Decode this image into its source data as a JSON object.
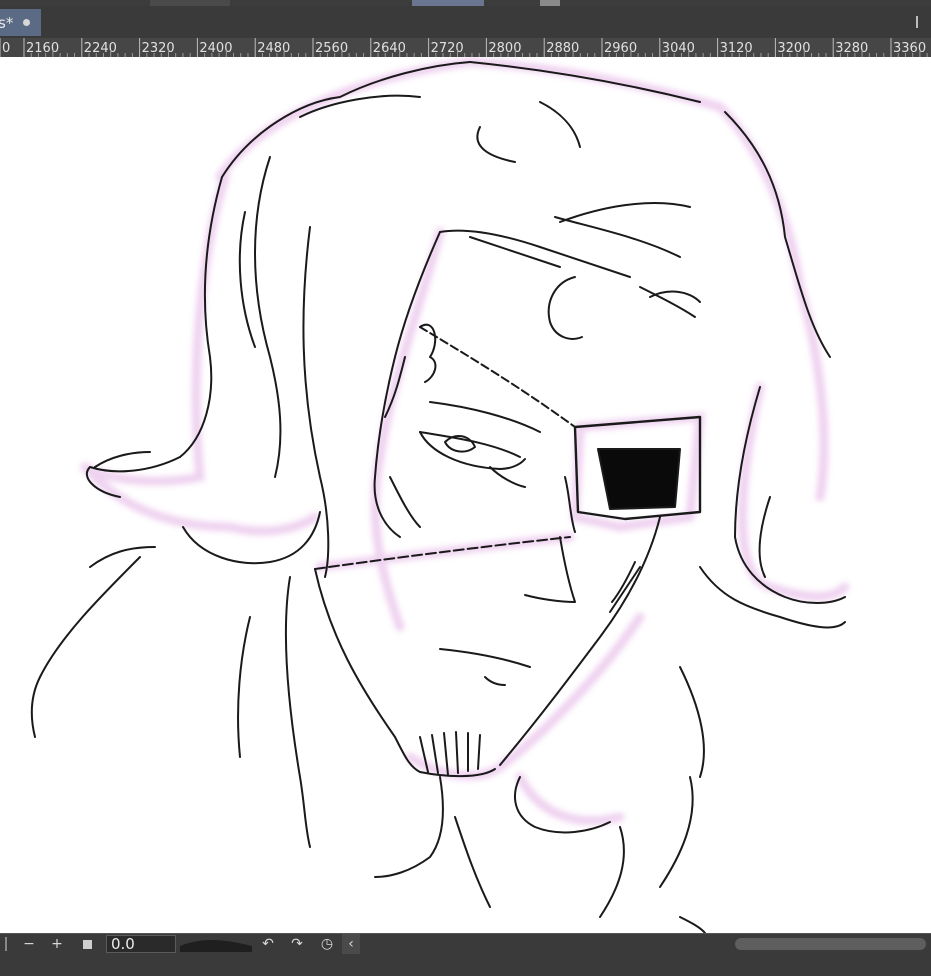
{
  "document_tab": {
    "label": "s*"
  },
  "ruler": {
    "labels": [
      "0",
      "2160",
      "2240",
      "2320",
      "2400",
      "2480",
      "2560",
      "2640",
      "2720",
      "2800",
      "2880",
      "2960",
      "3040",
      "3120",
      "3200",
      "3280",
      "3360"
    ]
  },
  "zoom": {
    "value": "0.0"
  },
  "colors": {
    "canvas": "#ffffff",
    "ink": "#1a1a1a",
    "pink_glow": "#e9c6ea",
    "tab_active": "#5c6b85",
    "panel": "#3a3a3a"
  },
  "icons": [
    "close-dot-icon",
    "zoom-out-icon",
    "zoom-in-icon",
    "stop-icon",
    "rotate-left-icon",
    "rotate-right-icon",
    "reset-rotation-icon",
    "chevron-left-icon"
  ]
}
